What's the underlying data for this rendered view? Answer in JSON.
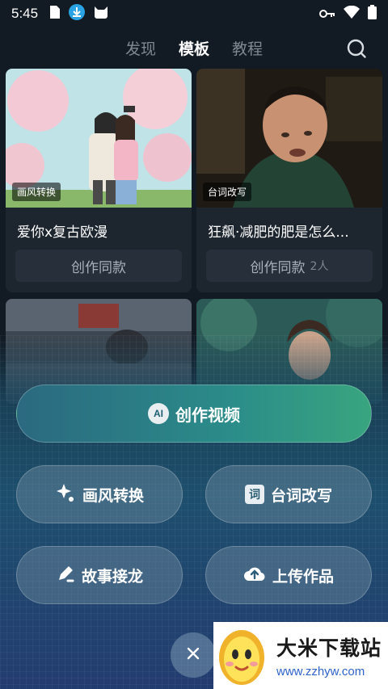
{
  "status_bar": {
    "time": "5:45"
  },
  "top_nav": {
    "tabs": [
      {
        "label": "发现",
        "active": false
      },
      {
        "label": "模板",
        "active": true
      },
      {
        "label": "教程",
        "active": false
      }
    ]
  },
  "cards": [
    {
      "badge": "画风转换",
      "title": "爱你x复古欧漫",
      "button": "创作同款",
      "count": ""
    },
    {
      "badge": "台词改写",
      "title": "狂飙·减肥的肥是怎么...",
      "button": "创作同款",
      "count": "2人"
    }
  ],
  "actions": {
    "create_video": "创作视频",
    "ai_label": "AI",
    "style_transfer": "画风转换",
    "rewrite_lines": "台词改写",
    "story_continue": "故事接龙",
    "upload_works": "上传作品",
    "rewrite_icon_char": "词"
  },
  "watermark": {
    "title": "大米下载站",
    "url": "www.zzhyw.com"
  },
  "colors": {
    "background": "#121a23",
    "card": "#1d252f",
    "accent_green": "#39a57f",
    "url_blue": "#2e64c8"
  },
  "icons": [
    "document-icon",
    "download-icon",
    "cat-icon",
    "key-icon",
    "wifi-icon",
    "battery-icon",
    "search-icon",
    "sparkle-icon",
    "pen-icon",
    "cloud-upload-icon",
    "close-icon"
  ]
}
